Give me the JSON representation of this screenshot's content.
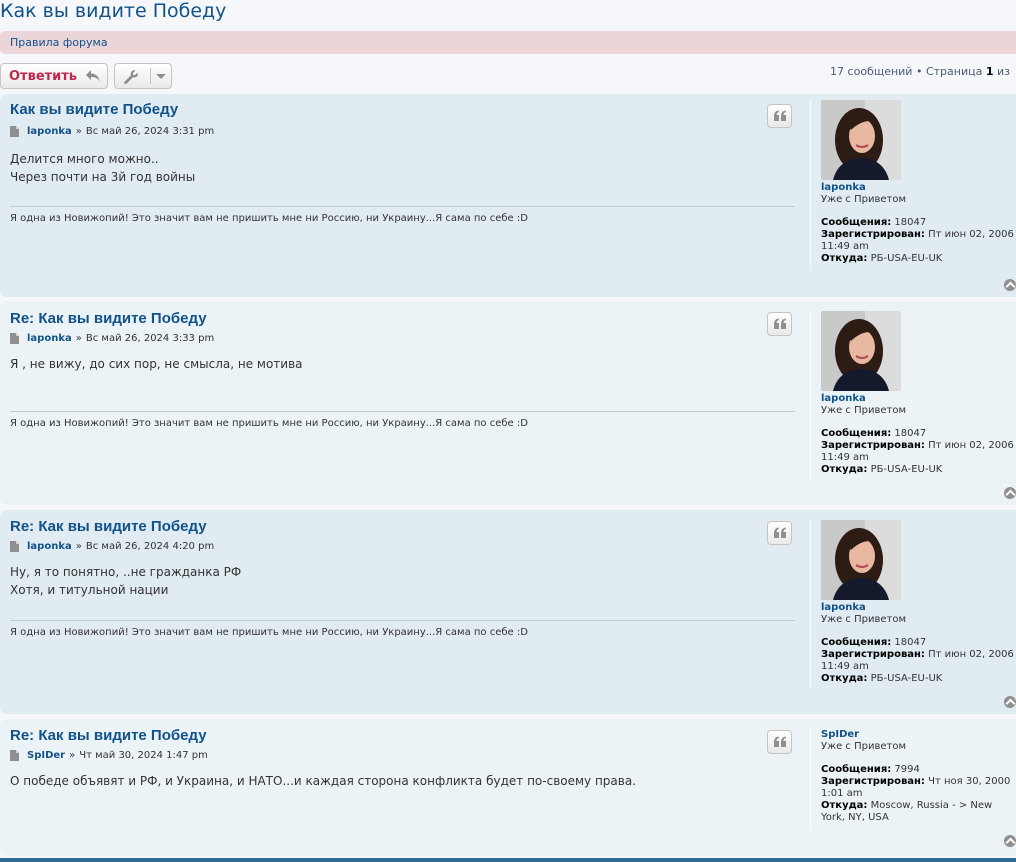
{
  "topic": {
    "title": "Как вы видите Победу",
    "rules_link": "Правила форума"
  },
  "toolbar": {
    "reply_label": "Ответить",
    "reply_icon": "reply-arrow-icon",
    "tools_icon": "wrench-icon",
    "dropdown_icon": "caret-down-icon"
  },
  "pagination": {
    "count": "17 сообщений",
    "bullet": "•",
    "page_label": "Страница",
    "page_number": "1",
    "of": "из"
  },
  "colors": {
    "link": "#105289",
    "reply_text": "#bc2a4d",
    "post_bg_dark": "#e1ebf2",
    "post_bg_light": "#ecf3f7",
    "rules_bg": "#ecd5d8"
  },
  "posts": [
    {
      "title": "Как вы видите Победу",
      "author": "laponka",
      "separator": "»",
      "date": "Вс май 26, 2024 3:31 pm",
      "lines": [
        "Делится много можно..",
        "Через почти на 3й год войны"
      ],
      "signature": "Я одна из Новижопий! Это значит вам не пришить мне ни Россию, ни Украину...Я сама по себе :D",
      "profile": {
        "username": "laponka",
        "rank": "Уже с Приветом",
        "posts_label": "Сообщения:",
        "posts": "18047",
        "joined_label": "Зарегистрирован:",
        "joined": "Пт июн 02, 2006 11:49 am",
        "location_label": "Откуда:",
        "location": "РБ-USA-EU-UK"
      }
    },
    {
      "title": "Re: Как вы видите Победу",
      "author": "laponka",
      "separator": "»",
      "date": "Вс май 26, 2024 3:33 pm",
      "lines": [
        "Я , не вижу, до сих пор, не смысла, не мотива"
      ],
      "signature": "Я одна из Новижопий! Это значит вам не пришить мне ни Россию, ни Украину...Я сама по себе :D",
      "profile": {
        "username": "laponka",
        "rank": "Уже с Приветом",
        "posts_label": "Сообщения:",
        "posts": "18047",
        "joined_label": "Зарегистрирован:",
        "joined": "Пт июн 02, 2006 11:49 am",
        "location_label": "Откуда:",
        "location": "РБ-USA-EU-UK"
      }
    },
    {
      "title": "Re: Как вы видите Победу",
      "author": "laponka",
      "separator": "»",
      "date": "Вс май 26, 2024 4:20 pm",
      "lines": [
        "Ну, я то понятно, ..не гражданка РФ",
        "Хотя, и титульной нации"
      ],
      "signature": "Я одна из Новижопий! Это значит вам не пришить мне ни Россию, ни Украину...Я сама по себе :D",
      "profile": {
        "username": "laponka",
        "rank": "Уже с Приветом",
        "posts_label": "Сообщения:",
        "posts": "18047",
        "joined_label": "Зарегистрирован:",
        "joined": "Пт июн 02, 2006 11:49 am",
        "location_label": "Откуда:",
        "location": "РБ-USA-EU-UK"
      }
    },
    {
      "title": "Re: Как вы видите Победу",
      "author": "SpIDer",
      "separator": "»",
      "date": "Чт май 30, 2024 1:47 pm",
      "lines": [
        "О победе объявят и РФ, и Украина, и НАТО...и каждая сторона конфликта будет по-своему права."
      ],
      "signature": "",
      "profile": {
        "username": "SpIDer",
        "rank": "Уже с Приветом",
        "posts_label": "Сообщения:",
        "posts": "7994",
        "joined_label": "Зарегистрирован:",
        "joined": "Чт ноя 30, 2000 1:01 am",
        "location_label": "Откуда:",
        "location": "Moscow, Russia - > New York, NY, USA"
      }
    }
  ]
}
